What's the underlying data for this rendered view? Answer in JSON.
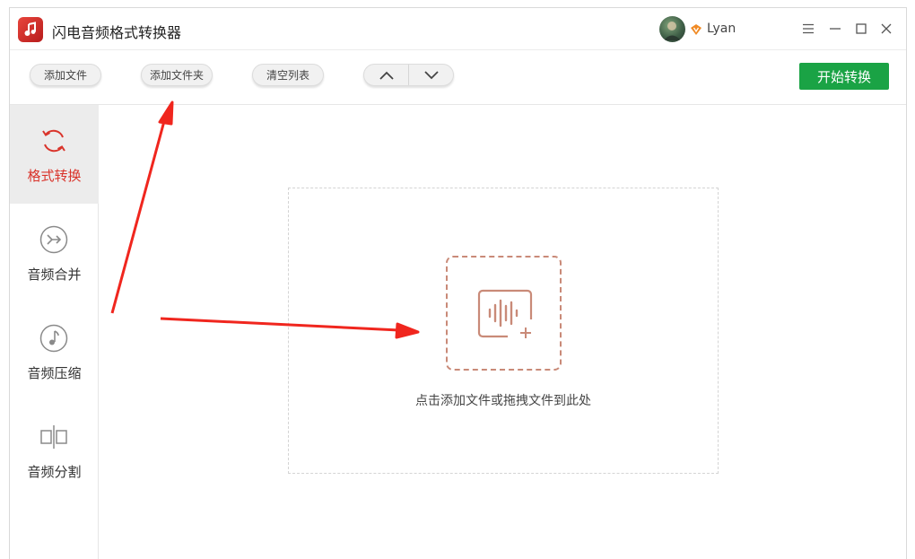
{
  "app": {
    "title": "闪电音频格式转换器",
    "logo_icon": "music-note-icon"
  },
  "user": {
    "name": "Lyan",
    "vip_icon": "vip-crown-icon",
    "avatar_icon": "avatar"
  },
  "window_controls": [
    "menu-icon",
    "minimize-icon",
    "maximize-icon",
    "close-icon"
  ],
  "toolbar": {
    "add_file": "添加文件",
    "add_folder": "添加文件夹",
    "clear_list": "清空列表",
    "move_up_icon": "chevron-up-icon",
    "move_down_icon": "chevron-down-icon",
    "start_convert": "开始转换"
  },
  "sidebar": {
    "items": [
      {
        "label": "格式转换",
        "icon": "convert-icon",
        "active": true
      },
      {
        "label": "音频合并",
        "icon": "merge-icon",
        "active": false
      },
      {
        "label": "音频压缩",
        "icon": "compress-icon",
        "active": false
      },
      {
        "label": "音频分割",
        "icon": "split-icon",
        "active": false
      }
    ]
  },
  "dropzone": {
    "icon": "add-audio-icon",
    "text": "点击添加文件或拖拽文件到此处"
  },
  "colors": {
    "accent_red": "#d9342b",
    "start_green": "#1aa345",
    "dropzone_icon": "#c98a78",
    "annotation_arrow": "#f0261e"
  }
}
